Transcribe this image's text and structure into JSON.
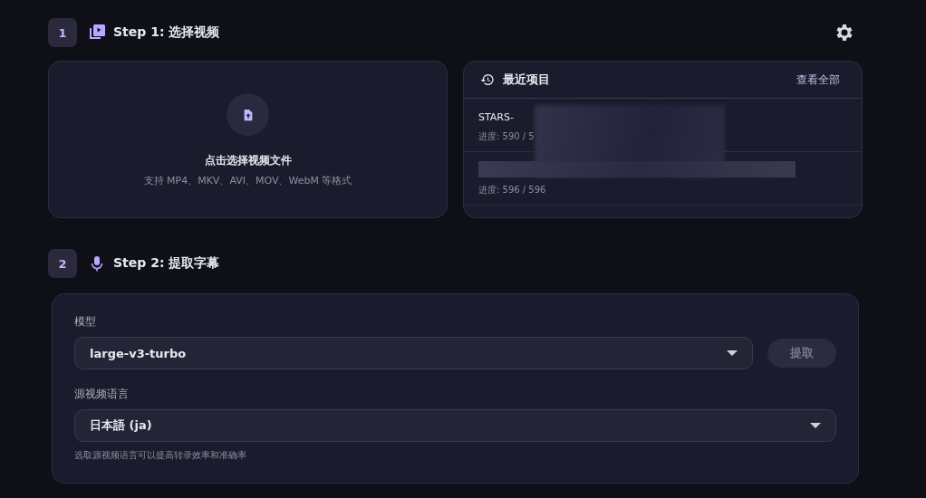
{
  "step1": {
    "number": "1",
    "title": "Step 1: 选择视频"
  },
  "upload": {
    "title": "点击选择视频文件",
    "hint": "支持 MP4、MKV、AVI、MOV、WebM 等格式"
  },
  "recent": {
    "title": "最近项目",
    "view_all": "查看全部",
    "items": [
      {
        "name": "STARS-",
        "progress": "进度: 590 / 5"
      },
      {
        "progress": "进度: 596 / 596"
      }
    ]
  },
  "step2": {
    "number": "2",
    "title": "Step 2: 提取字幕"
  },
  "model": {
    "label": "模型",
    "value": "large-v3-turbo"
  },
  "extract_button": {
    "label": "提取",
    "disabled": true
  },
  "language": {
    "label": "源视频语言",
    "value": "日本語 (ja)",
    "hint": "选取源视频语言可以提高转录效率和准确率"
  }
}
